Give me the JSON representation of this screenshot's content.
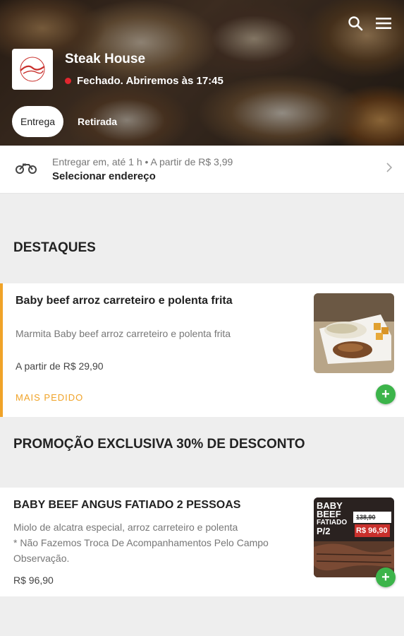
{
  "store": {
    "name": "Steak House",
    "status": "Fechado. Abriremos às 17:45",
    "status_color": "#e3262f",
    "logo_alt": "Steak House"
  },
  "header": {
    "icons": [
      "search-icon",
      "menu-icon"
    ]
  },
  "modes": {
    "delivery_label": "Entrega",
    "pickup_label": "Retirada"
  },
  "delivery_bar": {
    "info": "Entregar em, até 1 h  •  A partir de R$ 3,99",
    "action": "Selecionar endereço",
    "icon": "motorcycle-icon"
  },
  "sections": [
    {
      "title": "DESTAQUES",
      "items": [
        {
          "title": "Baby beef arroz carreteiro e polenta frita",
          "description": "Marmita Baby beef arroz carreteiro e polenta frita",
          "price": "A partir de R$ 29,90",
          "badge": "MAIS PEDIDO"
        }
      ]
    },
    {
      "title": "PROMOÇÃO EXCLUSIVA 30% DE DESCONTO",
      "items": [
        {
          "title": "BABY BEEF ANGUS FATIADO 2 PESSOAS",
          "description_line1": "Miolo de alcatra especial, arroz carreteiro e polenta",
          "description_line2": "* Não Fazemos Troca De Acompanhamentos Pelo Campo Observação.",
          "price": "R$ 96,90",
          "image_text": {
            "line1": "BABY",
            "line2": "BEEF",
            "line3": "FATIADO",
            "line4": "P/2",
            "old_price": "138,90",
            "new_price": "R$ 96,90"
          }
        }
      ]
    }
  ],
  "colors": {
    "accent": "#f0a328",
    "add_button": "#3cb44a"
  }
}
